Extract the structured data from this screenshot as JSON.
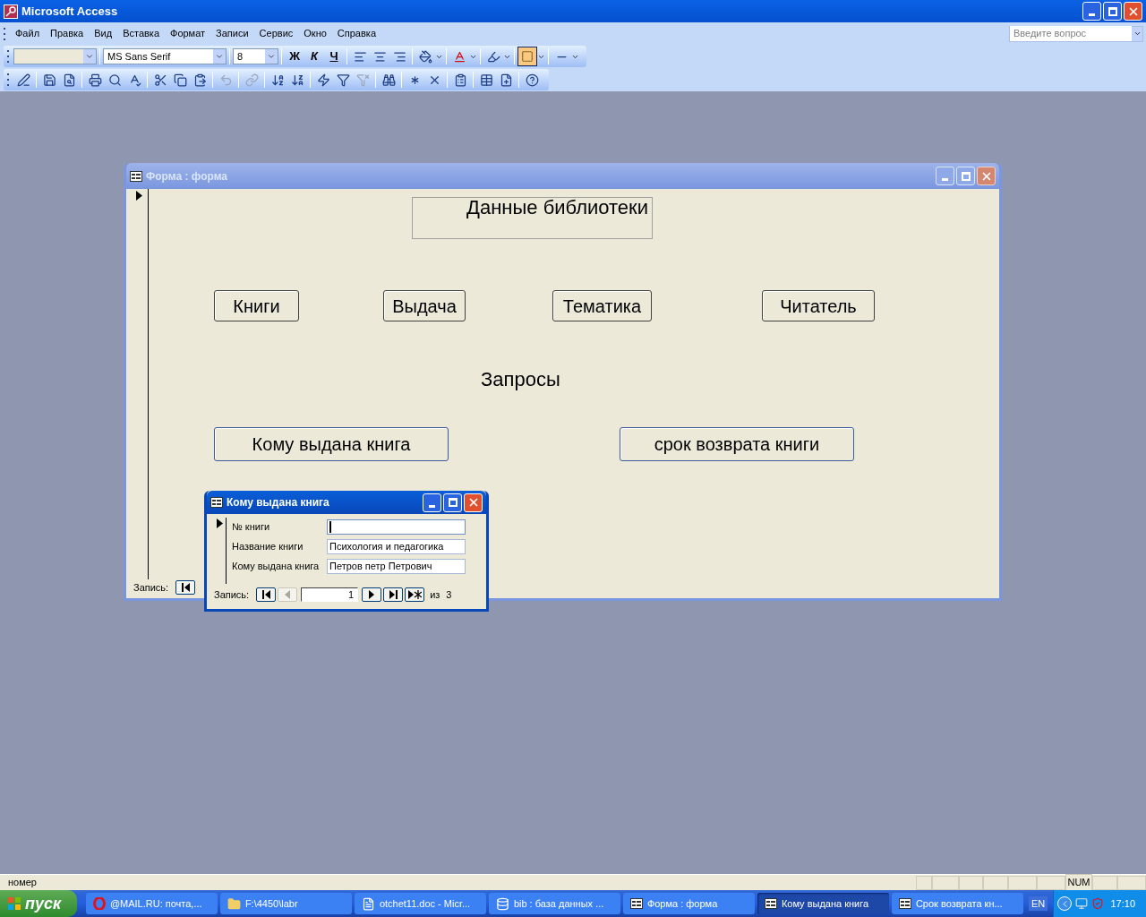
{
  "app_window": {
    "title": "Microsoft Access"
  },
  "menu": [
    "Файл",
    "Правка",
    "Вид",
    "Вставка",
    "Формат",
    "Записи",
    "Сервис",
    "Окно",
    "Справка"
  ],
  "help_box": {
    "placeholder": "Введите вопрос"
  },
  "format_toolbar": {
    "font_name": "MS Sans Serif",
    "font_size": "8",
    "style_buttons": [
      "Ж",
      "К",
      "Ч"
    ]
  },
  "main_form": {
    "title": "Форма : форма",
    "active": false,
    "heading": "Данные библиотеки",
    "buttons": [
      {
        "label": "Книги"
      },
      {
        "label": "Выдача"
      },
      {
        "label": "Тематика"
      },
      {
        "label": "Читатель"
      }
    ],
    "section_label": "Запросы",
    "query_buttons": [
      {
        "label": "Кому выдана книга"
      },
      {
        "label": "срок возврата книги"
      }
    ],
    "nav": {
      "label": "Запись:"
    }
  },
  "subform": {
    "title": "Кому выдана книга",
    "active": true,
    "fields": [
      {
        "label": "№ книги",
        "focused": true
      },
      {
        "label": "Название книги",
        "value": "Психология и педагогика",
        "focused": false
      },
      {
        "label": "Кому выдана книга",
        "value": "Петров петр Петрович",
        "focused": false
      }
    ],
    "nav": {
      "label": "Запись:",
      "buttons": [
        {
          "kind": "first",
          "disabled": false
        },
        {
          "kind": "prev",
          "disabled": true
        }
      ],
      "current": "1",
      "buttons_after": [
        {
          "kind": "next",
          "disabled": false
        },
        {
          "kind": "last",
          "disabled": false
        },
        {
          "kind": "new",
          "disabled": false
        }
      ],
      "of_label": "из",
      "total": "3"
    }
  },
  "status_bar": {
    "text": "номер",
    "indicator": "NUM"
  },
  "taskbar": {
    "start": "пуск",
    "tasks": [
      {
        "label": "@MAIL.RU: почта,...",
        "kind": "browser",
        "selected": false
      },
      {
        "label": "F:\\4450\\labr",
        "kind": "folder",
        "selected": false
      },
      {
        "label": "otchet11.doc - Micr...",
        "kind": "document",
        "selected": false
      },
      {
        "label": "bib : база данных ...",
        "kind": "database",
        "selected": false
      },
      {
        "label": "Форма : форма",
        "kind": "form",
        "selected": false
      },
      {
        "label": "Кому выдана книга",
        "kind": "form",
        "selected": true
      },
      {
        "label": "Срок возврата кн...",
        "kind": "form",
        "selected": false
      }
    ],
    "language": "EN",
    "clock": "17:10"
  }
}
